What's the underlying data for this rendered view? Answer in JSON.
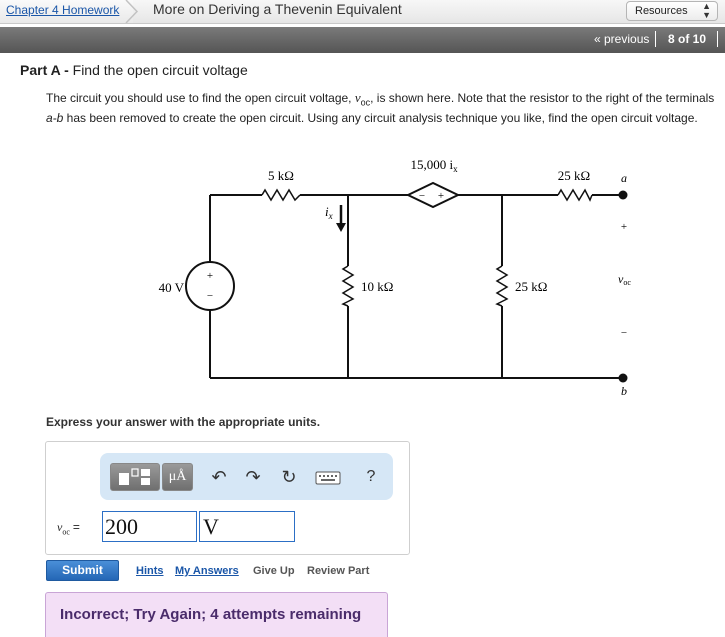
{
  "topbar": {
    "breadcrumb_link": "Chapter 4 Homework",
    "breadcrumb_title": "More on Deriving a Thevenin Equivalent",
    "resources_label": "Resources"
  },
  "navbar": {
    "previous_label": "« previous",
    "page_counter": "8 of 10"
  },
  "part": {
    "label": "Part A -",
    "title": "Find the open circuit voltage"
  },
  "description": {
    "text_1": "The circuit you should use to find the open circuit voltage, ",
    "voc_symbol": "v",
    "voc_sub": "oc",
    "text_2": ", is shown here. Note that the resistor to the right of the terminals ",
    "terminals": "a-b",
    "text_3": " has been removed to create the open circuit. Using any circuit analysis technique you like, find the open circuit voltage."
  },
  "circuit": {
    "r1_label": "5 kΩ",
    "dep_source_label": "15,000 i",
    "dep_source_sub": "x",
    "dep_minus": "−",
    "dep_plus": "+",
    "r4_label": "25 kΩ",
    "terminal_a": "a",
    "terminal_b": "b",
    "ix_label": "i",
    "ix_sub": "x",
    "vs_label": "40 V",
    "vs_plus": "+",
    "vs_minus": "−",
    "r2_label": "10 kΩ",
    "r3_label": "25 kΩ",
    "voc_plus": "+",
    "voc_minus": "−",
    "voc_label": "v",
    "voc_sub": "oc"
  },
  "instructions": "Express your answer with the appropriate units.",
  "toolbar": {
    "units_symbol": "μÅ",
    "help_symbol": "?",
    "icons": [
      "templates-icon",
      "units-icon",
      "undo-icon",
      "redo-icon",
      "reset-icon",
      "keyboard-icon",
      "help-icon"
    ]
  },
  "answer": {
    "variable": "v",
    "variable_sub": "oc",
    "equals": "=",
    "value": "200",
    "unit": "V"
  },
  "actions": {
    "submit_label": "Submit",
    "hints_label": "Hints",
    "my_answers_label": "My Answers",
    "give_up_label": "Give Up",
    "review_part_label": "Review Part"
  },
  "feedback": {
    "message": "Incorrect; Try Again; 4 attempts remaining"
  },
  "colors": {
    "link": "#1a56a8",
    "navbar": "#666666",
    "toolbar_bg": "#d6e7f6",
    "submit": "#2466b5",
    "feedback_bg": "#f3dff6",
    "feedback_text": "#4a2c6b"
  }
}
